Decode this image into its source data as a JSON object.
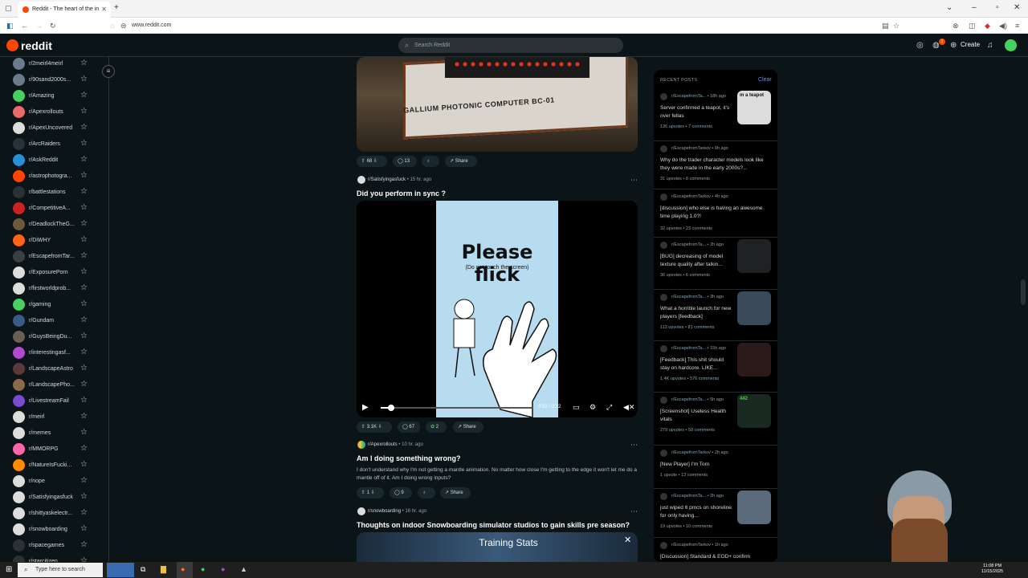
{
  "browser": {
    "tab_title": "Reddit - The heart of the in",
    "url": "www.reddit.com"
  },
  "header": {
    "logo": "reddit",
    "search_placeholder": "Search Reddit",
    "create_label": "Create",
    "notif_count": "1"
  },
  "sidebar": {
    "items": [
      {
        "name": "r/2meirl4meirl",
        "color": "#6b7b8c"
      },
      {
        "name": "r/90sand2000s...",
        "color": "#6b7b8c"
      },
      {
        "name": "r/Amazing",
        "color": "#46d160"
      },
      {
        "name": "r/Apexrollouts",
        "color": "#e86b6b"
      },
      {
        "name": "r/ApexUncovered",
        "color": "#dddddd"
      },
      {
        "name": "r/ArcRaiders",
        "color": "#2a3236"
      },
      {
        "name": "r/AskReddit",
        "color": "#2b8fd6"
      },
      {
        "name": "r/astrophotogra...",
        "color": "#ff4500"
      },
      {
        "name": "r/battlestations",
        "color": "#2a3236"
      },
      {
        "name": "r/CompetitiveA...",
        "color": "#cc2222"
      },
      {
        "name": "r/DeadlockTheG...",
        "color": "#6b5a3c"
      },
      {
        "name": "r/DiWHY",
        "color": "#ff6314"
      },
      {
        "name": "r/EscapefromTar...",
        "color": "#3a3f42"
      },
      {
        "name": "r/ExposurePorn",
        "color": "#dddddd"
      },
      {
        "name": "r/firstworldprob...",
        "color": "#dddddd"
      },
      {
        "name": "r/gaming",
        "color": "#46d160"
      },
      {
        "name": "r/Gundam",
        "color": "#3a5a8a"
      },
      {
        "name": "r/GuysBeingDu...",
        "color": "#6a5f50"
      },
      {
        "name": "r/interestingasf...",
        "color": "#b04ad0"
      },
      {
        "name": "r/LandscapeAstro",
        "color": "#5a3a3a"
      },
      {
        "name": "r/LandscapePho...",
        "color": "#8a6a4a"
      },
      {
        "name": "r/LivestreamFail",
        "color": "#7a4ad0"
      },
      {
        "name": "r/meirl",
        "color": "#dddddd"
      },
      {
        "name": "r/memes",
        "color": "#dddddd"
      },
      {
        "name": "r/MMORPG",
        "color": "#ff66aa"
      },
      {
        "name": "r/NatureIsFucki...",
        "color": "#ff8c00"
      },
      {
        "name": "r/nope",
        "color": "#dddddd"
      },
      {
        "name": "r/Satisfyingasfuck",
        "color": "#dddddd"
      },
      {
        "name": "r/shittyaskelectr...",
        "color": "#dddddd"
      },
      {
        "name": "r/snowboarding",
        "color": "#dddddd"
      },
      {
        "name": "r/spacegames",
        "color": "#2a3236"
      },
      {
        "name": "r/starcitizen",
        "color": "#2a3236"
      }
    ]
  },
  "posts": [
    {
      "media_text": "GALLIUM PHOTONIC COMPUTER BC-01",
      "upvotes": "68",
      "comments": "13",
      "share": "Share"
    },
    {
      "subreddit": "r/Satisfyingasfuck",
      "time": "15 hr. ago",
      "title": "Did you perform in sync ?",
      "video_headline": "Please flick",
      "video_sub": "(Do not touch the screen)",
      "time_display": "0:02 / 0:22",
      "progress": 0.07,
      "upvotes": "3.1K",
      "comments": "67",
      "awards": "2",
      "share": "Share"
    },
    {
      "subreddit": "r/Apexrollouts",
      "time": "10 hr. ago",
      "title": "Am I doing something wrong?",
      "body": "I don't understand why I'm not getting a mantle animation. No matter how close I'm getting to the edge it won't let me do a mantle off of it. Am I doing wrong inputs?",
      "upvotes": "1",
      "comments": "9",
      "share": "Share"
    },
    {
      "subreddit": "r/snowboarding",
      "time": "16 hr. ago",
      "title": "Thoughts on indoor Snowboarding simulator studios to gain skills pre season?",
      "media_text": "Training Stats"
    }
  ],
  "recent": {
    "heading": "RECENT POSTS",
    "clear": "Clear",
    "items": [
      {
        "sub": "r/EscapefromTa...",
        "time": "18h ago",
        "title": "Server confirmed a teapot, it's over fellas",
        "upvotes": "136 upvotes",
        "comments": "7 comments",
        "thumb": "#dcdcdc",
        "thumb_text": "m a teapot"
      },
      {
        "sub": "r/EscapefromTarkov",
        "time": "9h ago",
        "title": "Why do the trader character models look like they were made in the early 2000s?...",
        "upvotes": "31 upvotes",
        "comments": "8 comments"
      },
      {
        "sub": "r/EscapefromTarkov",
        "time": "4h ago",
        "title": "[discussion] who else is having an awesome time playing 1.0?!",
        "upvotes": "32 upvotes",
        "comments": "23 comments"
      },
      {
        "sub": "r/EscapefromTa...",
        "time": "2h ago",
        "title": "[BUG] decreasing of model texture quality after talkin...",
        "upvotes": "36 upvotes",
        "comments": "6 comments",
        "thumb": "#1e2224"
      },
      {
        "sub": "r/EscapefromTa...",
        "time": "3h ago",
        "title": "What a horrible launch for new players [feedback]",
        "upvotes": "113 upvotes",
        "comments": "81 comments",
        "thumb": "#3a4a5a"
      },
      {
        "sub": "r/EscapefromTa...",
        "time": "15h ago",
        "title": "[Feedback] This shit should stay on hardcore. LIKE...",
        "upvotes": "1.4K upvotes",
        "comments": "576 comments",
        "thumb": "#2a1a1a"
      },
      {
        "sub": "r/EscapefromTa...",
        "time": "5h ago",
        "title": "[Screenshot] Useless Health vitals",
        "upvotes": "279 upvotes",
        "comments": "59 comments",
        "thumb": "#1a2a22",
        "thumb_text": "442"
      },
      {
        "sub": "r/EscapefromTarkov",
        "time": "2h ago",
        "title": "[New Player] I'm Torn",
        "upvotes": "1 upvote",
        "comments": "13 comments"
      },
      {
        "sub": "r/EscapefromTa...",
        "time": "2h ago",
        "title": "just wiped 6 pmcs on shoreline. for only having...",
        "upvotes": "19 upvotes",
        "comments": "10 comments",
        "thumb": "#5a6a7a"
      },
      {
        "sub": "r/EscapefromTarkov",
        "time": "1h ago",
        "title": "[Discussion] Standard & EOD+ confirm",
        "upvotes": "",
        "comments": ""
      }
    ]
  },
  "taskbar": {
    "search_placeholder": "Type here to search",
    "time": "11:08 PM",
    "date": "11/15/2025"
  }
}
